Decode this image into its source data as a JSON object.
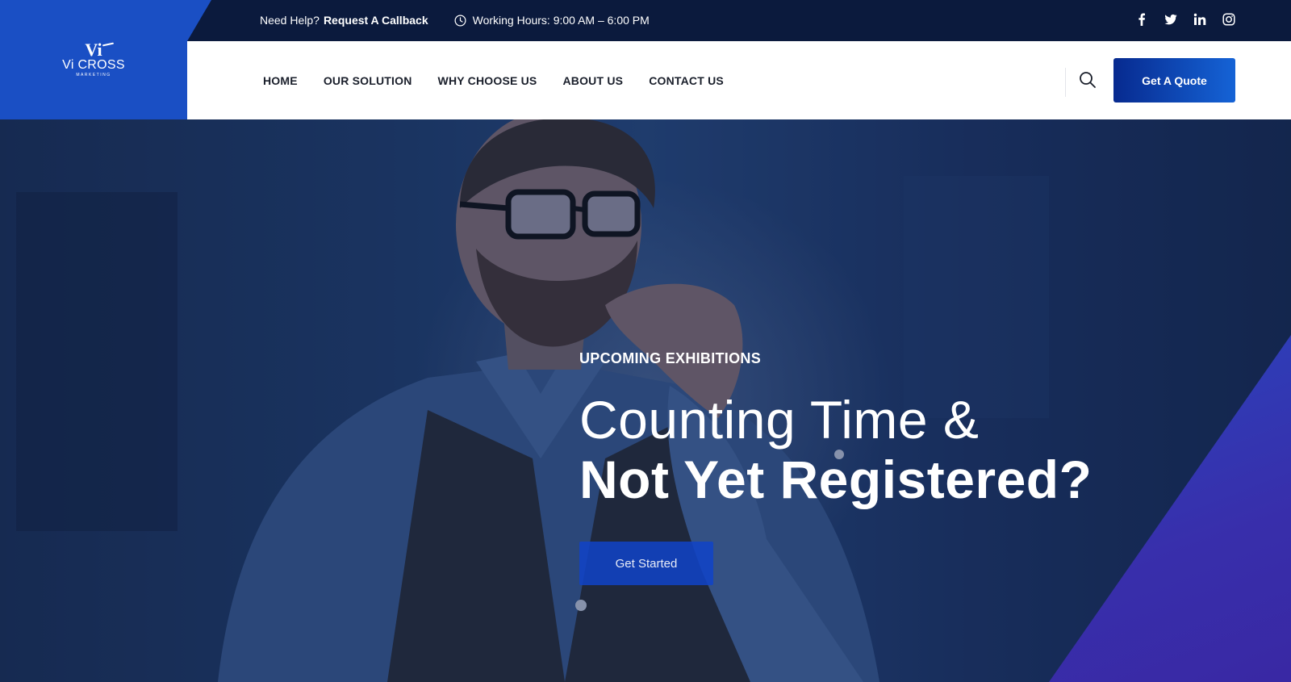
{
  "brand": {
    "mark": "Vi",
    "name": "Vi CROSS",
    "tagline": "MARKETING",
    "color": "#1a4fc4"
  },
  "topbar": {
    "help_prefix": "Need Help?",
    "help_link": "Request A Callback",
    "hours": "Working Hours: 9:00 AM – 6:00 PM",
    "hours_icon": "clock-icon",
    "socials": [
      {
        "name": "facebook",
        "icon": "facebook-icon"
      },
      {
        "name": "twitter",
        "icon": "twitter-icon"
      },
      {
        "name": "linkedin",
        "icon": "linkedin-icon"
      },
      {
        "name": "instagram",
        "icon": "instagram-icon"
      }
    ],
    "background": "#0b1a3d"
  },
  "nav": {
    "items": [
      {
        "label": "HOME"
      },
      {
        "label": "OUR SOLUTION"
      },
      {
        "label": "WHY CHOOSE US"
      },
      {
        "label": "ABOUT US"
      },
      {
        "label": "CONTACT US"
      }
    ],
    "search_icon": "search-icon",
    "quote_label": "Get A Quote"
  },
  "hero": {
    "eyebrow": "UPCOMING EXHIBITIONS",
    "heading_line1": "Counting Time &",
    "heading_line2": "Not Yet Registered?",
    "cta_label": "Get Started",
    "accent": "#1143c8"
  }
}
